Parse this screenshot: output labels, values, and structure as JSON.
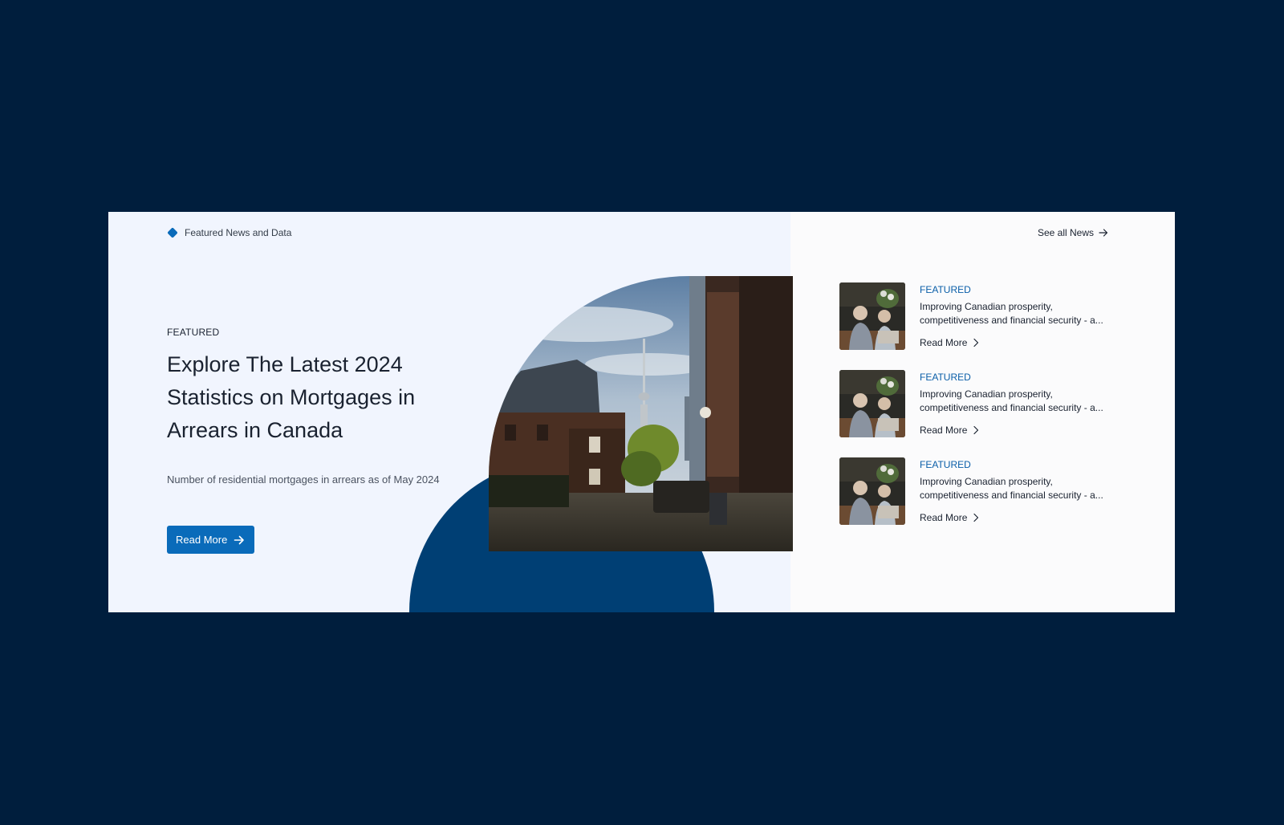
{
  "section": {
    "label": "Featured News and Data",
    "see_all_label": "See all News"
  },
  "hero": {
    "eyebrow": "FEATURED",
    "headline": "Explore The Latest 2024 Statistics on Mortgages in Arrears in Canada",
    "subtext": "Number of residential mortgages in arrears as of May 2024",
    "button_label": "Read More",
    "image_icon": "city-street-photo"
  },
  "news": [
    {
      "tag": "FEATURED",
      "title_line1": "Improving Canadian prosperity,",
      "title_line2": "competitiveness and financial security - a...",
      "read_label": "Read More"
    },
    {
      "tag": "FEATURED",
      "title_line1": "Improving Canadian prosperity,",
      "title_line2": "competitiveness and financial security - a...",
      "read_label": "Read More"
    },
    {
      "tag": "FEATURED",
      "title_line1": "Improving Canadian prosperity,",
      "title_line2": "competitiveness and financial security - a...",
      "read_label": "Read More"
    }
  ],
  "colors": {
    "page_background": "#001e3d",
    "card_background": "#f1f5fe",
    "accent_blue": "#0a6bba",
    "circle_blue": "#003f74"
  }
}
